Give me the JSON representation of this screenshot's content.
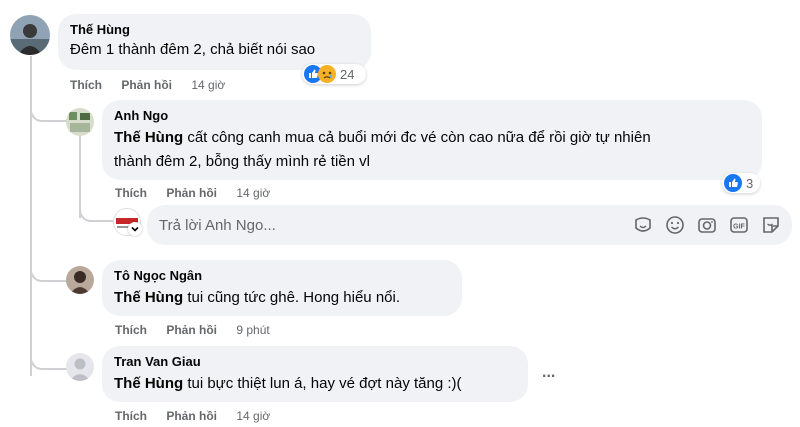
{
  "comments": [
    {
      "author": "Thế Hùng",
      "text": "Đêm 1 thành đêm 2, chả biết nói sao",
      "actions": {
        "like": "Thích",
        "reply": "Phản hồi",
        "time": "14 giờ"
      },
      "reactions": {
        "count": "24",
        "types": [
          "like-icon",
          "sad-icon"
        ]
      }
    },
    {
      "author": "Anh Ngo",
      "mention": "Thế Hùng",
      "text_line1": " cất công canh mua cả buổi mới đc vé còn cao nữa để rồi giờ tự nhiên",
      "text_line2": "thành đêm 2, bỗng thấy mình rẻ tiền vl",
      "actions": {
        "like": "Thích",
        "reply": "Phản hồi",
        "time": "14 giờ"
      },
      "reactions": {
        "count": "3",
        "types": [
          "like-icon"
        ]
      }
    },
    {
      "author": "Tô Ngọc Ngân",
      "mention": "Thế Hùng",
      "text": " tui cũng tức ghê. Hong hiểu nổi.",
      "actions": {
        "like": "Thích",
        "reply": "Phản hồi",
        "time": "9 phút"
      }
    },
    {
      "author": "Tran Van Giau",
      "mention": "Thế Hùng",
      "text": " tui bực thiệt lun á, hay vé đợt này tăng :)(",
      "actions": {
        "like": "Thích",
        "reply": "Phản hồi",
        "time": "14 giờ"
      }
    }
  ],
  "reply_box": {
    "placeholder": "Trả lời Anh Ngo...",
    "tools": [
      "sticker-face-icon",
      "emoji-icon",
      "camera-icon",
      "gif-icon",
      "sticker-icon"
    ]
  },
  "more_options": "...",
  "colors": {
    "bubble": "#f0f2f5",
    "like_blue": "#1877f2",
    "sad_yellow": "#f7b125",
    "secondary_text": "#65676b"
  }
}
